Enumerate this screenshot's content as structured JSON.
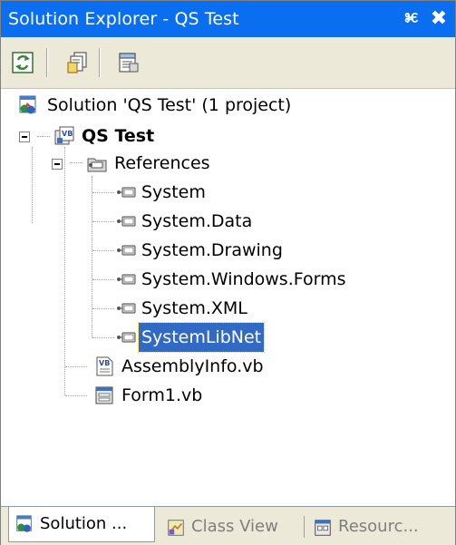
{
  "window": {
    "title": "Solution Explorer - QS Test",
    "pin_glyph": "ⱘ",
    "close_glyph": "✖"
  },
  "toolbar": {
    "buttons": [
      {
        "name": "refresh-button",
        "icon": "refresh-icon"
      },
      {
        "name": "show-all-files-button",
        "icon": "show-all-files-icon"
      },
      {
        "name": "properties-button",
        "icon": "properties-icon"
      }
    ]
  },
  "tree": {
    "solution": "Solution 'QS Test' (1 project)",
    "project": "QS Test",
    "references_folder": "References",
    "references": [
      "System",
      "System.Data",
      "System.Drawing",
      "System.Windows.Forms",
      "System.XML",
      "SystemLibNet"
    ],
    "selected_reference_index": 5,
    "files": [
      "AssemblyInfo.vb",
      "Form1.vb"
    ]
  },
  "tabs": [
    {
      "label": "Solution ...",
      "icon": "solution-explorer-icon",
      "active": true
    },
    {
      "label": "Class View",
      "icon": "class-view-icon",
      "active": false
    },
    {
      "label": "Resourc...",
      "icon": "resource-view-icon",
      "active": false
    }
  ],
  "colors": {
    "titlebar": "#0a6ef0",
    "selection": "#316ac5",
    "toolbar_bg": "#ece9d8"
  }
}
